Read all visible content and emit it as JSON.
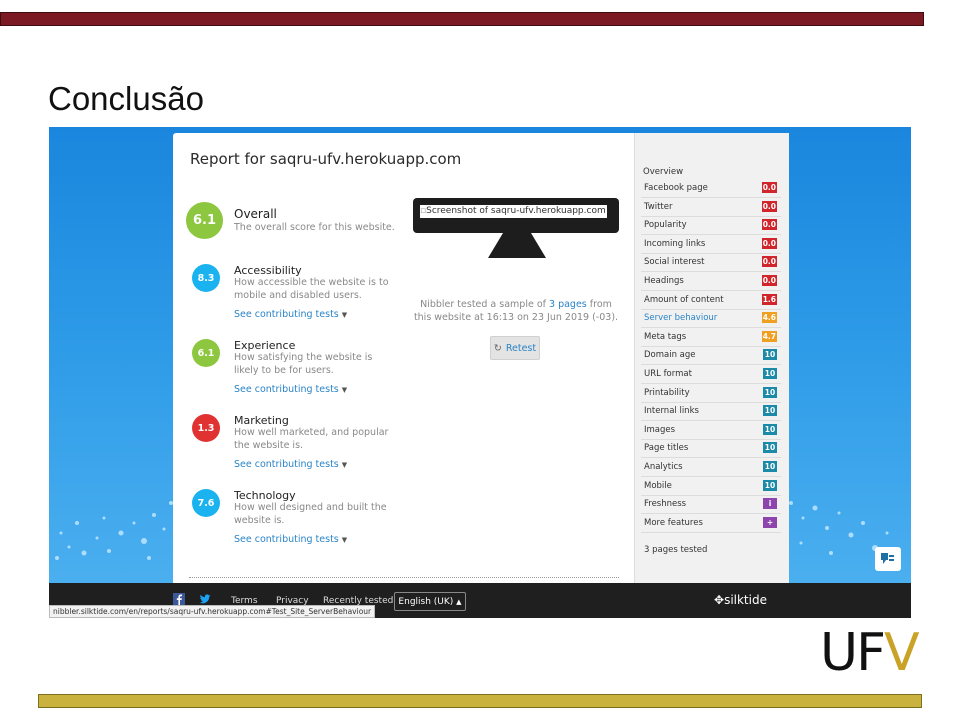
{
  "slide": {
    "title": "Conclusão",
    "logo": {
      "u": "U",
      "f": "F",
      "v": "V"
    },
    "colors": {
      "top_bar": "#7b1a22",
      "bottom_bar": "#c9b23e",
      "logo_dark": "#111111",
      "logo_gold": "#c9a227"
    }
  },
  "report": {
    "title": "Report for saqru-ufv.herokuapp.com",
    "sections": [
      {
        "name": "Overall",
        "score": "6.1",
        "desc": "The overall score for this website.",
        "color": "#8dc63f",
        "contrib": ""
      },
      {
        "name": "Accessibility",
        "score": "8.3",
        "desc": "How accessible the website is to mobile and disabled users.",
        "color": "#1ab3f0",
        "contrib": "See contributing tests"
      },
      {
        "name": "Experience",
        "score": "6.1",
        "desc": "How satisfying the website is likely to be for users.",
        "color": "#8dc63f",
        "contrib": "See contributing tests"
      },
      {
        "name": "Marketing",
        "score": "1.3",
        "desc": "How well marketed, and popular the website is.",
        "color": "#e13232",
        "contrib": "See contributing tests"
      },
      {
        "name": "Technology",
        "score": "7.6",
        "desc": "How well designed and built the website is.",
        "color": "#1ab3f0",
        "contrib": "See contributing tests"
      }
    ],
    "screenshot_alt": "Screenshot of saqru-ufv.herokuapp.com",
    "tested": {
      "before": "Nibbler tested a sample of ",
      "link": "3 pages",
      "after": " from this website at 16:13 on 23 Jun 2019 (-03)."
    },
    "retest_label": "Retest"
  },
  "sidebar": {
    "overview": "Overview",
    "items": [
      {
        "label": "Facebook page",
        "badge": "0.0",
        "color": "#d0262b",
        "active": false
      },
      {
        "label": "Twitter",
        "badge": "0.0",
        "color": "#d0262b",
        "active": false
      },
      {
        "label": "Popularity",
        "badge": "0.0",
        "color": "#d0262b",
        "active": false
      },
      {
        "label": "Incoming links",
        "badge": "0.0",
        "color": "#d0262b",
        "active": false
      },
      {
        "label": "Social interest",
        "badge": "0.0",
        "color": "#d0262b",
        "active": false
      },
      {
        "label": "Headings",
        "badge": "0.0",
        "color": "#d0262b",
        "active": false
      },
      {
        "label": "Amount of content",
        "badge": "1.6",
        "color": "#d0262b",
        "active": false
      },
      {
        "label": "Server behaviour",
        "badge": "4.6",
        "color": "#f0a020",
        "active": true
      },
      {
        "label": "Meta tags",
        "badge": "4.7",
        "color": "#f0a020",
        "active": false
      },
      {
        "label": "Domain age",
        "badge": "10",
        "color": "#1a8aa8",
        "active": false
      },
      {
        "label": "URL format",
        "badge": "10",
        "color": "#1a8aa8",
        "active": false
      },
      {
        "label": "Printability",
        "badge": "10",
        "color": "#1a8aa8",
        "active": false
      },
      {
        "label": "Internal links",
        "badge": "10",
        "color": "#1a8aa8",
        "active": false
      },
      {
        "label": "Images",
        "badge": "10",
        "color": "#1a8aa8",
        "active": false
      },
      {
        "label": "Page titles",
        "badge": "10",
        "color": "#1a8aa8",
        "active": false
      },
      {
        "label": "Analytics",
        "badge": "10",
        "color": "#1a8aa8",
        "active": false
      },
      {
        "label": "Mobile",
        "badge": "10",
        "color": "#1a8aa8",
        "active": false
      },
      {
        "label": "Freshness",
        "badge": "i",
        "color": "#8e44ad",
        "active": false
      },
      {
        "label": "More features",
        "badge": "+",
        "color": "#8e44ad",
        "active": false
      }
    ],
    "pages_tested": "3 pages tested"
  },
  "footer": {
    "links": [
      "Terms",
      "Privacy",
      "Recently tested"
    ],
    "language": "English (UK)",
    "brand": "silktide",
    "status_url": "nibbler.silktide.com/en/reports/saqru-ufv.herokuapp.com#Test_Site_ServerBehaviour"
  }
}
